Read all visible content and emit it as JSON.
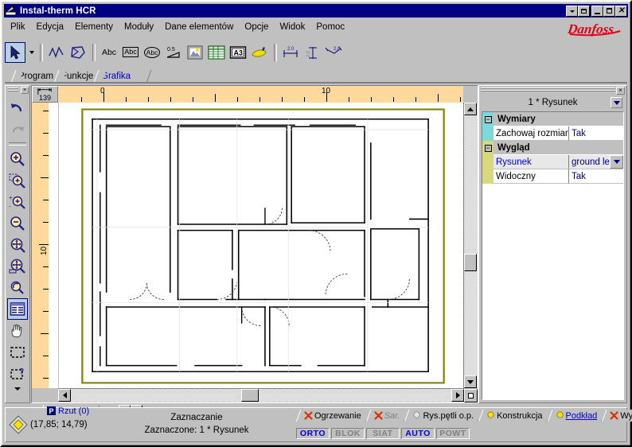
{
  "window": {
    "title": "Instal-therm HCR",
    "icon": "app-pen-icon",
    "buttons": {
      "dropdown": "▼",
      "restore": "restore",
      "minimize": "_",
      "maximize": "maximize",
      "close": "✕"
    }
  },
  "menu": {
    "items": [
      {
        "label": "Plik"
      },
      {
        "label": "Edycja"
      },
      {
        "label": "Elementy"
      },
      {
        "label": "Moduły"
      },
      {
        "label": "Dane elementów"
      },
      {
        "label": "Opcje"
      },
      {
        "label": "Widok"
      },
      {
        "label": "Pomoc"
      }
    ],
    "logo": "Danfoss"
  },
  "toolbar": {
    "items": [
      {
        "name": "select-arrow-tool",
        "label": "Wskaźnik",
        "pressed": true
      },
      {
        "name": "select-dropdown",
        "label": "▼",
        "pressed": false
      },
      {
        "name": "polyline-tool",
        "label": "Linia łamana",
        "pressed": false
      },
      {
        "name": "polygon-tool",
        "label": "Wielokąt",
        "pressed": false
      },
      {
        "name": "text-abc-tool",
        "label": "Abc",
        "pressed": false
      },
      {
        "name": "text-boxed-abc-tool",
        "label": "Abc w ramce",
        "pressed": false
      },
      {
        "name": "text-ellipse-abc-tool",
        "label": "Abc w elipsie",
        "pressed": false
      },
      {
        "name": "line-width-tool",
        "label": "0.5",
        "pressed": false
      },
      {
        "name": "image-tool",
        "label": "Rysunek",
        "pressed": false
      },
      {
        "name": "table-tool",
        "label": "Tabela",
        "pressed": false
      },
      {
        "name": "sheet-a3-tool",
        "label": "A3",
        "pressed": false
      },
      {
        "name": "highlighter-tool",
        "label": "Zakreślacz",
        "pressed": false
      },
      {
        "name": "dim-horizontal-tool",
        "label": "Wymiar poziomy",
        "pressed": false
      },
      {
        "name": "dim-vertical-tool",
        "label": "Wymiar pionowy",
        "pressed": false
      },
      {
        "name": "dim-angular-tool",
        "label": "Wymiar kątowy",
        "pressed": false
      }
    ]
  },
  "tabs": {
    "items": [
      {
        "label": "Program",
        "active": false
      },
      {
        "label": "Funkcje",
        "active": false
      },
      {
        "label": "Grafika",
        "active": true
      }
    ]
  },
  "left_toolbar": {
    "close_label": "×",
    "items": [
      {
        "name": "undo-tool",
        "label": "Cofnij",
        "pressed": false
      },
      {
        "name": "redo-tool",
        "label": "Ponów",
        "pressed": false
      },
      {
        "name": "separator",
        "label": "",
        "pressed": false
      },
      {
        "name": "zoom-in-tool",
        "label": "Powiększ",
        "pressed": false
      },
      {
        "name": "zoom-window-tool",
        "label": "Powiększ okno",
        "pressed": false
      },
      {
        "name": "zoom-plus-minus-tool",
        "label": "Skala",
        "pressed": false
      },
      {
        "name": "zoom-out-tool",
        "label": "Pomniejsz",
        "pressed": false
      },
      {
        "name": "zoom-fit-tool",
        "label": "Dopasuj",
        "pressed": false
      },
      {
        "name": "zoom-fit-selection-tool",
        "label": "Dopasuj zaznaczenie",
        "pressed": false
      },
      {
        "name": "zoom-previous-tool",
        "label": "Poprzedni widok",
        "pressed": false
      },
      {
        "name": "properties-tool",
        "label": "Właściwości",
        "pressed": true
      },
      {
        "name": "pan-hand-tool",
        "label": "Przesuń",
        "pressed": false
      },
      {
        "name": "marquee-select-tool",
        "label": "Zaznacz obszar",
        "pressed": false
      },
      {
        "name": "marquee-query-tool",
        "label": "Zapytanie",
        "pressed": false
      }
    ],
    "more_label": "▼"
  },
  "drawing": {
    "scale_label": "139",
    "ruler_h": {
      "labels": [
        {
          "text": "0",
          "pos": 62
        },
        {
          "text": "10",
          "pos": 337
        }
      ]
    },
    "ruler_v": {
      "labels": [
        {
          "text": "10",
          "pos": 160
        }
      ]
    },
    "sheet_tab": {
      "badge": "P",
      "label": "Rzut (0)"
    }
  },
  "properties": {
    "close_label": "×",
    "header_title": "1 * Rysunek",
    "header_dropdown": "▼",
    "groups": [
      {
        "name": "Wymiary",
        "expander": "−",
        "rows": [
          {
            "name": "Zachowaj rozmiar",
            "value": "Tak",
            "selected": false,
            "dropdown": false
          }
        ]
      },
      {
        "name": "Wygląd",
        "expander": "−",
        "rows": [
          {
            "name": "Rysunek",
            "value": "ground les",
            "selected": true,
            "dropdown": true
          },
          {
            "name": "Widoczny",
            "value": "Tak",
            "selected": false,
            "dropdown": false
          }
        ]
      }
    ]
  },
  "status": {
    "coordinates": "(17,85; 14,79)",
    "mode_title": "Zaznaczanie",
    "selection": "Zaznaczone: 1 * Rysunek",
    "layer_tabs": [
      {
        "label": "Ogrzewanie",
        "icon": "red-x-icon",
        "state": "off"
      },
      {
        "label": "Sar.",
        "icon": "red-x-icon",
        "state": "dim"
      },
      {
        "label": "Rys.pętli o.p.",
        "icon": "grey-bulb-icon",
        "state": "off"
      },
      {
        "label": "Konstrukcja",
        "icon": "yellow-bulb-icon",
        "state": "off"
      },
      {
        "label": "Podkład",
        "icon": "yellow-bulb-icon",
        "state": "active"
      },
      {
        "label": "Wydruk",
        "icon": "red-x-icon",
        "state": "off"
      }
    ],
    "modes": [
      {
        "label": "ORTO",
        "on": true
      },
      {
        "label": "BLOK",
        "on": false
      },
      {
        "label": "SIAT",
        "on": false
      },
      {
        "label": "AUTO",
        "on": true
      },
      {
        "label": "POWT",
        "on": false
      }
    ]
  },
  "colors": {
    "titlebar": "#000080",
    "face": "#c0c0c0",
    "ruler": "#ffd89b",
    "sheet_border": "#808000",
    "accent_link": "#0000d0",
    "brand": "#e2001a"
  }
}
